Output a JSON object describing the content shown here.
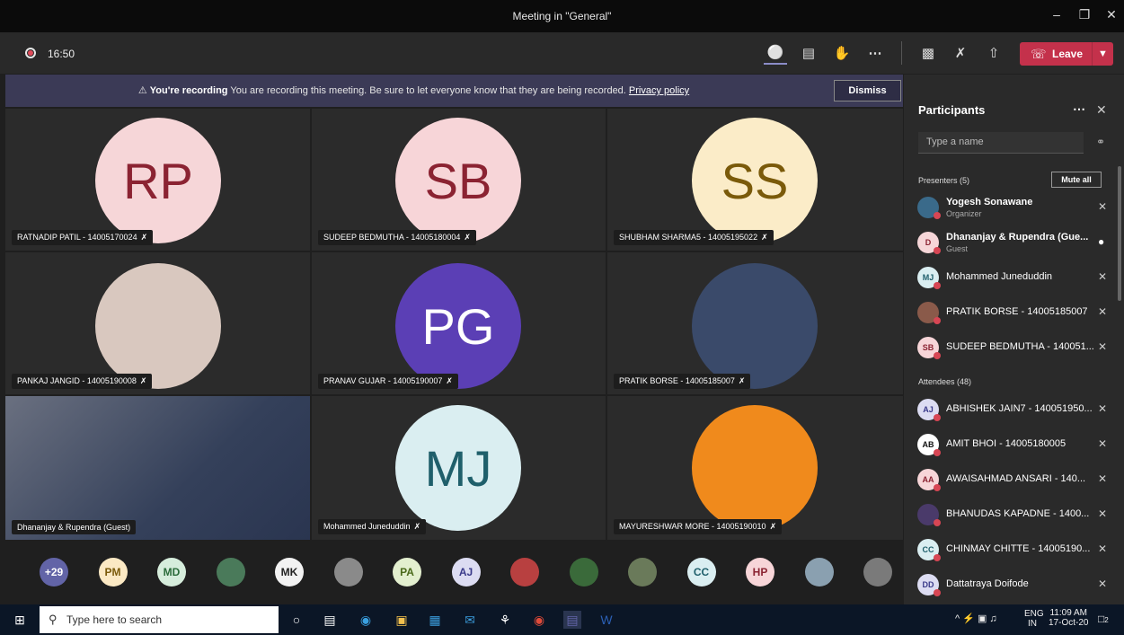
{
  "window": {
    "title": "Meeting in \"General\""
  },
  "controls": {
    "timer": "16:50",
    "leave_label": "Leave"
  },
  "banner": {
    "bold": "You're recording",
    "text": "You are recording this meeting. Be sure to let everyone know that they are being recorded.",
    "link": "Privacy policy",
    "dismiss": "Dismiss"
  },
  "tiles": [
    {
      "initials": "RP",
      "name": "RATNADIP PATIL - 14005170024",
      "bg": "#f6d6d8",
      "fg": "#8b2332"
    },
    {
      "initials": "SB",
      "name": "SUDEEP BEDMUTHA - 14005180004",
      "bg": "#f7d5d8",
      "fg": "#8b2332"
    },
    {
      "initials": "SS",
      "name": "SHUBHAM SHARMA5 - 14005195022",
      "bg": "#fbecc8",
      "fg": "#7a5a0a"
    },
    {
      "initials": "",
      "name": "PANKAJ JANGID - 14005190008",
      "bg": "#d9c8bf",
      "fg": "#333"
    },
    {
      "initials": "PG",
      "name": "PRANAV GUJAR - 14005190007",
      "bg": "#5b3fb5",
      "fg": "#ffffff"
    },
    {
      "initials": "",
      "name": "PRATIK BORSE - 14005185007",
      "bg": "#3a4a6a",
      "fg": "#fff"
    },
    {
      "initials": "",
      "name": "Dhananjay & Rupendra (Guest)",
      "bg": "#556",
      "fg": "#fff"
    },
    {
      "initials": "MJ",
      "name": "Mohammed Juneduddin",
      "bg": "#daeef1",
      "fg": "#1f5f6b"
    },
    {
      "initials": "",
      "name": "MAYURESHWAR MORE - 14005190010",
      "bg": "#f08a1c",
      "fg": "#fff"
    }
  ],
  "strip": [
    {
      "initials": "+29",
      "bg": "#6264a7",
      "fg": "#fff"
    },
    {
      "initials": "PM",
      "bg": "#fbe9c4",
      "fg": "#7a5a0a"
    },
    {
      "initials": "MD",
      "bg": "#d6eddc",
      "fg": "#2a6b3a"
    },
    {
      "initials": "",
      "bg": "#4a7a5a",
      "fg": "#fff"
    },
    {
      "initials": "MK",
      "bg": "#f2f2f2",
      "fg": "#222"
    },
    {
      "initials": "",
      "bg": "#8a8a8a",
      "fg": "#fff"
    },
    {
      "initials": "PA",
      "bg": "#e3efcf",
      "fg": "#4a6a1a"
    },
    {
      "initials": "AJ",
      "bg": "#dcdcf2",
      "fg": "#3a3a8a"
    },
    {
      "initials": "",
      "bg": "#b84040",
      "fg": "#fff"
    },
    {
      "initials": "",
      "bg": "#3a6a3a",
      "fg": "#fff"
    },
    {
      "initials": "",
      "bg": "#6a7a5a",
      "fg": "#fff"
    },
    {
      "initials": "CC",
      "bg": "#daeef1",
      "fg": "#1f5f6b"
    },
    {
      "initials": "HP",
      "bg": "#f7d5d8",
      "fg": "#8b2332"
    },
    {
      "initials": "",
      "bg": "#8aa0b0",
      "fg": "#fff"
    },
    {
      "initials": "",
      "bg": "#7a7a7a",
      "fg": "#fff"
    }
  ],
  "panel": {
    "title": "Participants",
    "search_placeholder": "Type a name",
    "presenters_label": "Presenters (5)",
    "mute_all": "Mute all",
    "attendees_label": "Attendees (48)",
    "presenters": [
      {
        "initials": "",
        "name": "Yogesh Sonawane",
        "role": "Organizer",
        "bg": "#3a6a8a",
        "fg": "#fff",
        "mic": "muted"
      },
      {
        "initials": "D",
        "name": "Dhananjay & Rupendra (Gue...",
        "role": "Guest",
        "bg": "#f6d6d8",
        "fg": "#8b2332",
        "mic": "on"
      },
      {
        "initials": "MJ",
        "name": "Mohammed Juneduddin",
        "role": "",
        "bg": "#daeef1",
        "fg": "#1f5f6b",
        "mic": "muted"
      },
      {
        "initials": "",
        "name": "PRATIK BORSE - 14005185007",
        "role": "",
        "bg": "#8a5a4a",
        "fg": "#fff",
        "mic": "muted"
      },
      {
        "initials": "SB",
        "name": "SUDEEP BEDMUTHA - 140051...",
        "role": "",
        "bg": "#f7d5d8",
        "fg": "#8b2332",
        "mic": "muted"
      }
    ],
    "attendees": [
      {
        "initials": "AJ",
        "name": "ABHISHEK JAIN7 - 140051950...",
        "bg": "#dcdcf2",
        "fg": "#3a3a8a"
      },
      {
        "initials": "AB",
        "name": "AMIT BHOI - 14005180005",
        "bg": "#ffffff",
        "fg": "#111"
      },
      {
        "initials": "AA",
        "name": "AWAISAHMAD ANSARI - 140...",
        "bg": "#f7d5d8",
        "fg": "#8b2332"
      },
      {
        "initials": "",
        "name": "BHANUDAS KAPADNE - 1400...",
        "bg": "#4a3a6a",
        "fg": "#fff"
      },
      {
        "initials": "CC",
        "name": "CHINMAY CHITTE - 14005190...",
        "bg": "#daeef1",
        "fg": "#1f5f6b"
      },
      {
        "initials": "DD",
        "name": "Dattatraya Doifode",
        "bg": "#dcdcf2",
        "fg": "#3a3a8a"
      }
    ]
  },
  "taskbar": {
    "search_placeholder": "Type here to search",
    "lang": "ENG",
    "region": "IN",
    "time": "11:09 AM",
    "date": "17-Oct-20",
    "badge": "2"
  }
}
